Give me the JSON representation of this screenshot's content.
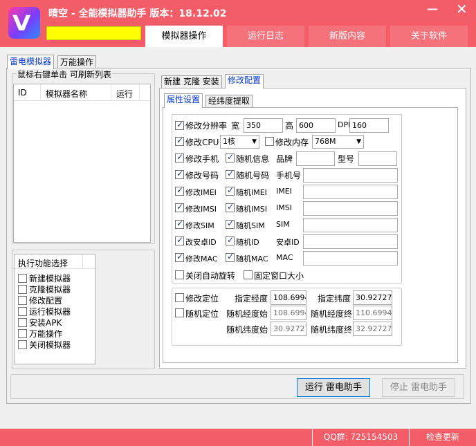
{
  "window": {
    "title": "晴空 - 全能模拟器助手 版本：18.12.02",
    "minimize_glyph": "—",
    "close_glyph": "✕",
    "icon": "app-logo-icon",
    "icon_letter": "V"
  },
  "top_tabs": [
    {
      "label": "模拟器操作",
      "active": true
    },
    {
      "label": "运行日志",
      "active": false
    },
    {
      "label": "新版内容",
      "active": false
    },
    {
      "label": "关于软件",
      "active": false
    }
  ],
  "main_tabs": [
    {
      "label": "雷电模拟器",
      "active": true
    },
    {
      "label": "万能操作",
      "active": false
    }
  ],
  "emulator_list": {
    "group_title": "鼠标右键单击 可刷新列表",
    "columns": [
      "ID",
      "模拟器名称",
      "运行"
    ]
  },
  "functions": {
    "header": "执行功能选择",
    "items": [
      "新建模拟器",
      "克隆模拟器",
      "修改配置",
      "运行模拟器",
      "安装APK",
      "万能操作",
      "关闭模拟器"
    ]
  },
  "right_tabs": [
    {
      "label": "新建 克隆 安装",
      "active": false
    },
    {
      "label": "修改配置",
      "active": true
    }
  ],
  "config_tabs": [
    {
      "label": "属性设置",
      "active": true
    },
    {
      "label": "经纬度提取",
      "active": false
    }
  ],
  "props": {
    "resolution": {
      "label": "修改分辨率",
      "checked": true,
      "width_label": "宽",
      "width": "350",
      "height_label": "高",
      "height": "600",
      "dpi_label": "DPI",
      "dpi": "160"
    },
    "cpu": {
      "label": "修改CPU",
      "checked": true,
      "value": "1核"
    },
    "memory": {
      "label": "修改内存",
      "checked": false,
      "value": "768M"
    },
    "phone": {
      "label": "修改手机",
      "checked": true,
      "random_label": "随机信息",
      "random_checked": true,
      "brand_label": "品牌",
      "brand": "",
      "model_label": "型号",
      "model": ""
    },
    "number": {
      "label": "修改号码",
      "checked": true,
      "random_label": "随机号码",
      "random_checked": true,
      "field_label": "手机号",
      "value": ""
    },
    "imei": {
      "label": "修改IMEI",
      "checked": true,
      "random_label": "随机IMEI",
      "random_checked": true,
      "field_label": "IMEI",
      "value": ""
    },
    "imsi": {
      "label": "修改IMSI",
      "checked": true,
      "random_label": "随机IMSI",
      "random_checked": true,
      "field_label": "IMSI",
      "value": ""
    },
    "sim": {
      "label": "修改SIM",
      "checked": true,
      "random_label": "随机SIM",
      "random_checked": true,
      "field_label": "SIM",
      "value": ""
    },
    "androidid": {
      "label": "改安卓ID",
      "checked": true,
      "random_label": "随机ID",
      "random_checked": true,
      "field_label": "安卓ID",
      "value": ""
    },
    "mac": {
      "label": "修改MAC",
      "checked": true,
      "random_label": "随机MAC",
      "random_checked": true,
      "field_label": "MAC",
      "value": ""
    },
    "auto_rotate": {
      "label": "关闭自动旋转",
      "checked": false
    },
    "fixed_window": {
      "label": "固定窗口大小",
      "checked": false
    }
  },
  "location": {
    "modify_label": "修改定位",
    "modify_checked": false,
    "random_label": "随机定位",
    "random_checked": false,
    "lng_label": "指定经度",
    "lng": "108.6994",
    "lat_label": "指定纬度",
    "lat": "30.92727",
    "rand_lng_start_label": "随机经度始",
    "rand_lng_start": "108.6994",
    "rand_lng_end_label": "随机经度终",
    "rand_lng_end": "110.69945",
    "rand_lat_start_label": "随机纬度始",
    "rand_lat_start": "30.92727",
    "rand_lat_end_label": "随机纬度终",
    "rand_lat_end": "32.92727"
  },
  "buttons": {
    "run": "运行 雷电助手",
    "stop": "停止 雷电助手"
  },
  "status": {
    "qq": "QQ群: 725154503",
    "update": "检查更新"
  }
}
